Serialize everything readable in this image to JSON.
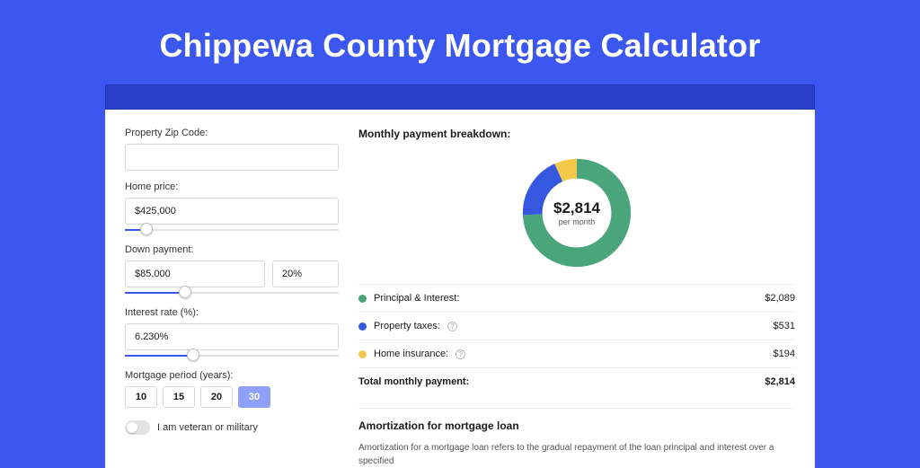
{
  "title": "Chippewa County Mortgage Calculator",
  "form": {
    "zip": {
      "label": "Property Zip Code:",
      "value": ""
    },
    "price": {
      "label": "Home price:",
      "value": "$425,000",
      "slider_pct": 10
    },
    "down": {
      "label": "Down payment:",
      "value": "$85,000",
      "pct": "20%",
      "slider_pct": 28
    },
    "rate": {
      "label": "Interest rate (%):",
      "value": "6.230%",
      "slider_pct": 32
    },
    "period": {
      "label": "Mortgage period (years):",
      "options": [
        "10",
        "15",
        "20",
        "30"
      ],
      "active": "30"
    },
    "veteran": {
      "label": "I am veteran or military",
      "on": false
    }
  },
  "breakdown": {
    "title": "Monthly payment breakdown:",
    "center_amount": "$2,814",
    "center_sub": "per month",
    "items": [
      {
        "label": "Principal & Interest:",
        "value": "$2,089",
        "color": "g"
      },
      {
        "label": "Property taxes:",
        "value": "$531",
        "color": "b",
        "info": true
      },
      {
        "label": "Home insurance:",
        "value": "$194",
        "color": "y",
        "info": true
      }
    ],
    "total": {
      "label": "Total monthly payment:",
      "value": "$2,814"
    }
  },
  "amort": {
    "title": "Amortization for mortgage loan",
    "text": "Amortization for a mortgage loan refers to the gradual repayment of the loan principal and interest over a specified"
  },
  "chart_data": {
    "type": "pie",
    "title": "Monthly payment breakdown",
    "series": [
      {
        "name": "Principal & Interest",
        "value": 2089,
        "color": "#4aa57a"
      },
      {
        "name": "Property taxes",
        "value": 531,
        "color": "#3658e0"
      },
      {
        "name": "Home insurance",
        "value": 194,
        "color": "#f3c84b"
      }
    ],
    "total": 2814,
    "center_label": "$2,814 per month"
  }
}
